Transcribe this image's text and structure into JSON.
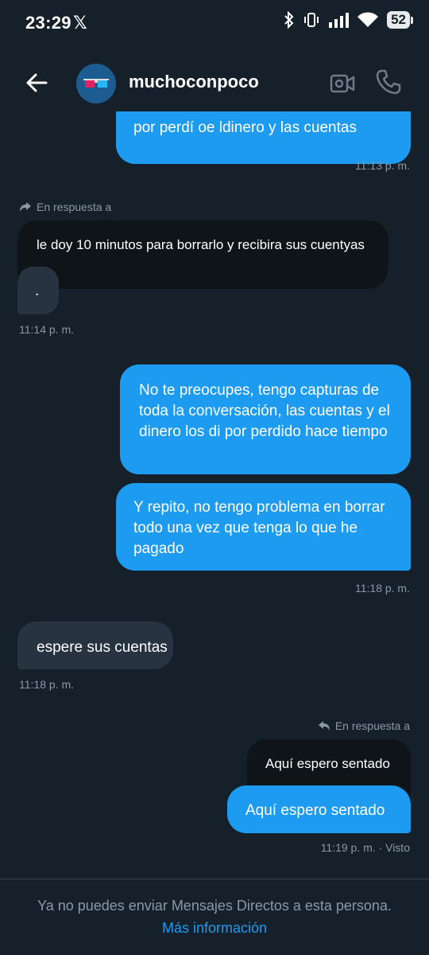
{
  "status_bar": {
    "time": "23:29",
    "x_label": "𝕏",
    "battery": "52"
  },
  "header": {
    "handle": "muchoconpoco",
    "avatar_icon": "3d-glasses-icon"
  },
  "messages": {
    "m1": {
      "text": "por perdí oe ldinero y las cuentas",
      "time": "11:13 p. m."
    },
    "reply1_label": "En respuesta a",
    "m2": {
      "text": "le doy 10 minutos para borrarlo y recibira sus cuentyas",
      "dot": ".",
      "time": "11:14 p. m."
    },
    "m3": {
      "text": "No te preocupes, tengo capturas de toda la conversación, las cuentas y el dinero los di por perdido hace tiempo"
    },
    "m4": {
      "text": "Y repito, no tengo problema en borrar todo una vez que tenga lo que he pagado",
      "time": "11:18 p. m."
    },
    "m5": {
      "text": "espere sus cuentas",
      "time": "11:18 p. m."
    },
    "reply2_label": "En respuesta a",
    "m6_quoted": {
      "text": "Aquí espero sentado"
    },
    "m6": {
      "text": "Aquí espero sentado",
      "time": "11:19 p. m. · Visto"
    }
  },
  "footer": {
    "notice": "Ya no puedes enviar Mensajes Directos a esta persona.",
    "link": "Más información"
  },
  "colors": {
    "background": "#15202b",
    "accent": "#1d9bf0",
    "incoming": "#273340",
    "muted": "#8b98a5"
  }
}
